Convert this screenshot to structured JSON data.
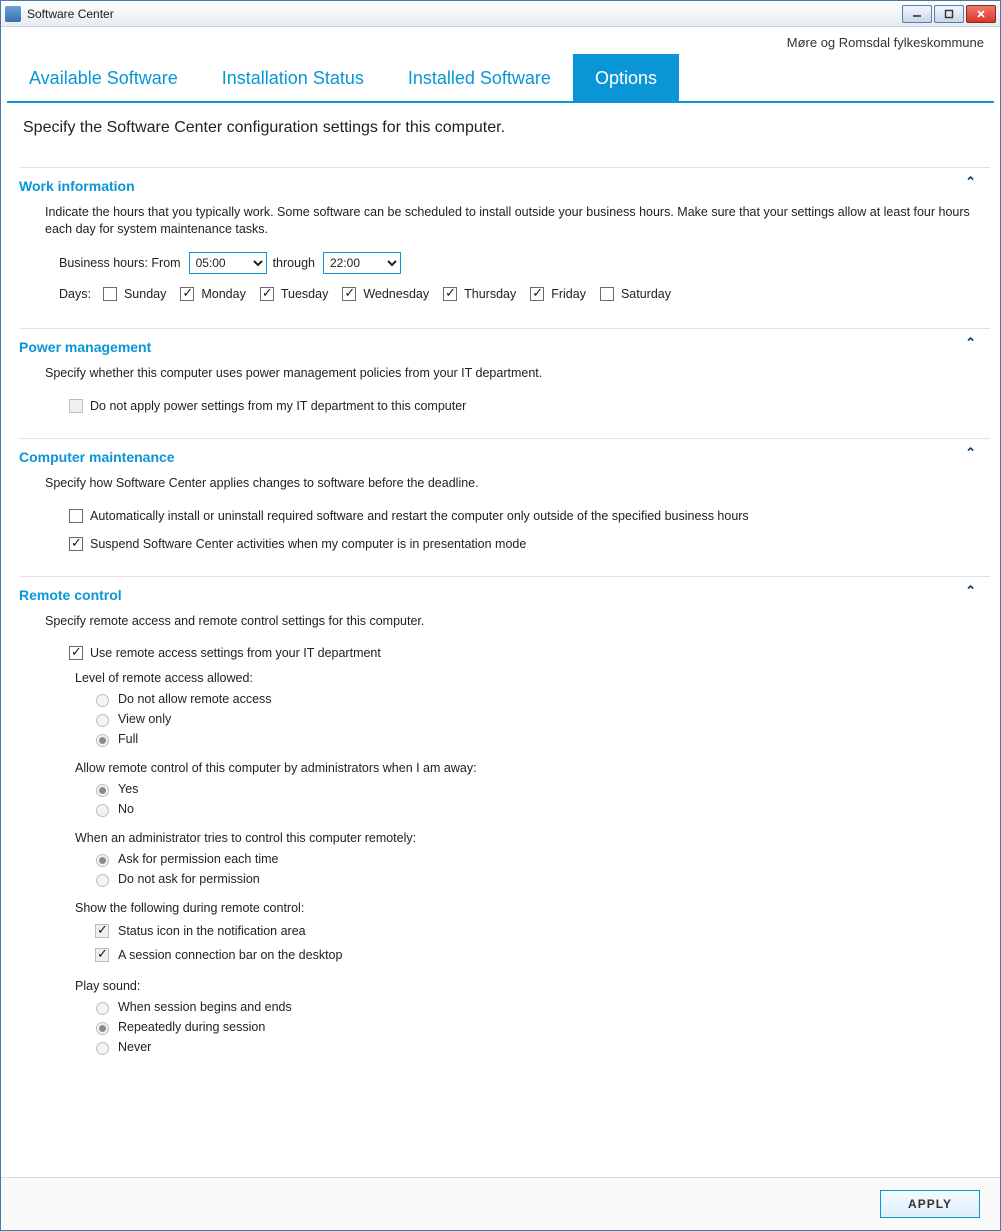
{
  "window": {
    "title": "Software Center"
  },
  "org": "Møre og Romsdal fylkeskommune",
  "tabs": {
    "available": "Available Software",
    "status": "Installation Status",
    "installed": "Installed Software",
    "options": "Options"
  },
  "intro": "Specify the Software Center configuration settings for this computer.",
  "work": {
    "title": "Work information",
    "desc": "Indicate the hours that you typically work. Some software can be scheduled to install outside your business hours. Make sure that your settings allow at least four hours each day for system maintenance tasks.",
    "bh_label": "Business hours: From",
    "from": "05:00",
    "through_label": "through",
    "to": "22:00",
    "days_label": "Days:",
    "days": {
      "sun": "Sunday",
      "mon": "Monday",
      "tue": "Tuesday",
      "wed": "Wednesday",
      "thu": "Thursday",
      "fri": "Friday",
      "sat": "Saturday"
    }
  },
  "power": {
    "title": "Power management",
    "desc": "Specify whether this computer uses power management policies from your IT department.",
    "opt": "Do not apply power settings from my IT department to this computer"
  },
  "maint": {
    "title": "Computer maintenance",
    "desc": "Specify how Software Center applies changes to software before the deadline.",
    "opt1": "Automatically install or uninstall required software and restart the computer only outside of the specified business hours",
    "opt2": "Suspend Software Center activities when my computer is in presentation mode"
  },
  "remote": {
    "title": "Remote control",
    "desc": "Specify remote access and remote control settings for this computer.",
    "useit": "Use remote access settings from your IT department",
    "level_label": "Level of remote access allowed:",
    "level": {
      "deny": "Do not allow remote access",
      "view": "View only",
      "full": "Full"
    },
    "away_label": "Allow remote control of this computer by administrators when I am away:",
    "away": {
      "yes": "Yes",
      "no": "No"
    },
    "try_label": "When an administrator tries to control this computer remotely:",
    "try": {
      "ask": "Ask for permission each time",
      "noask": "Do not ask for permission"
    },
    "show_label": "Show the following during remote control:",
    "show": {
      "icon": "Status icon in the notification area",
      "bar": "A session connection bar on the desktop"
    },
    "sound_label": "Play sound:",
    "sound": {
      "ends": "When session begins and ends",
      "repeat": "Repeatedly during session",
      "never": "Never"
    }
  },
  "footer": {
    "apply": "APPLY"
  }
}
